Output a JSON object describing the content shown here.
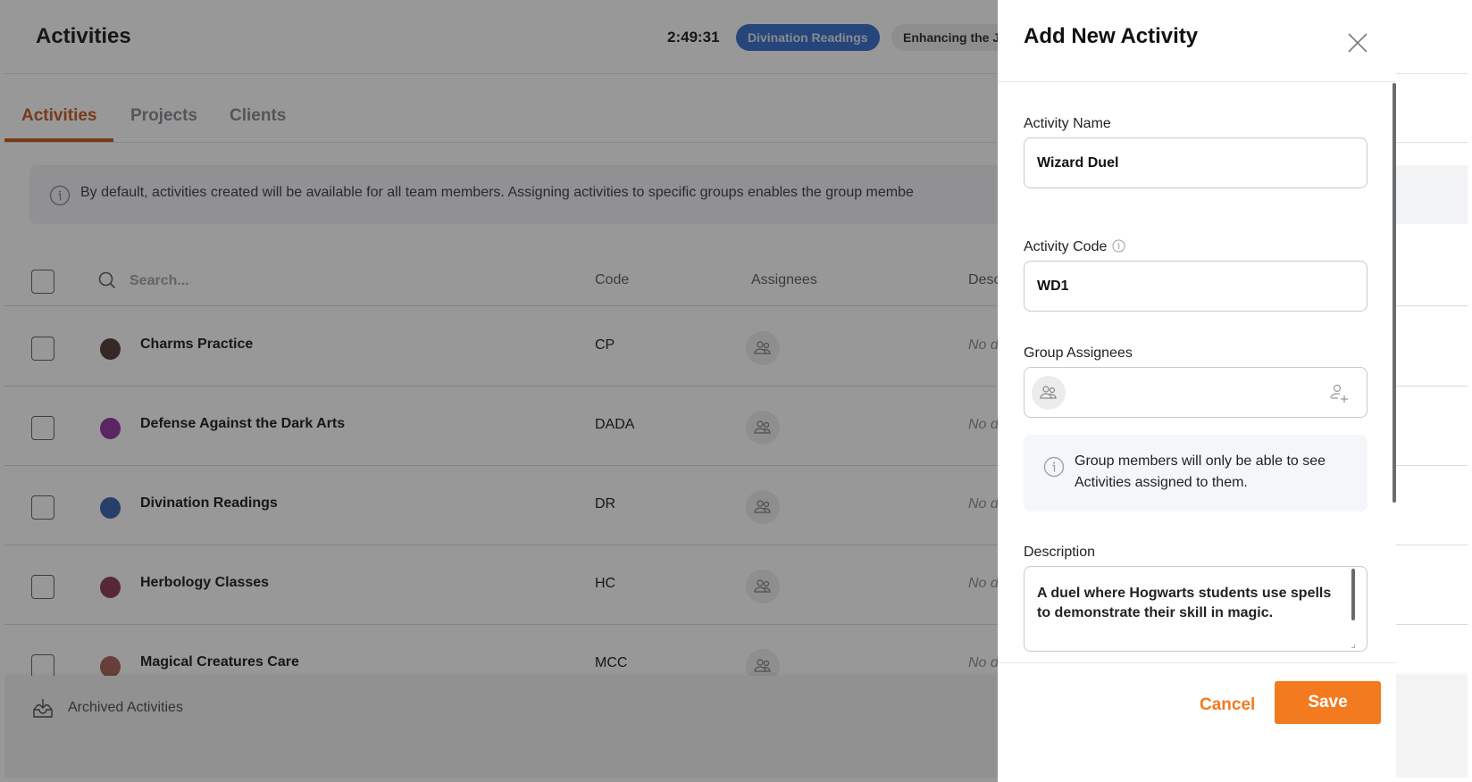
{
  "header": {
    "title": "Activities",
    "timer": "2:49:31",
    "active_chip": "Divination Readings",
    "next_chip": "Enhancing the J"
  },
  "tabs": [
    {
      "label": "Activities",
      "active": true
    },
    {
      "label": "Projects",
      "active": false
    },
    {
      "label": "Clients",
      "active": false
    }
  ],
  "banner": {
    "text": "By default, activities created will be available for all team members. Assigning activities to specific groups enables the group membe"
  },
  "table": {
    "search_placeholder": "Search...",
    "columns": {
      "code": "Code",
      "assignees": "Assignees",
      "description": "Desc"
    },
    "rows": [
      {
        "name": "Charms Practice",
        "code": "CP",
        "color": "#4a332c",
        "description": "No d"
      },
      {
        "name": "Defense Against the Dark Arts",
        "code": "DADA",
        "color": "#8e2a9e",
        "description": "No d"
      },
      {
        "name": "Divination Readings",
        "code": "DR",
        "color": "#2c5aab",
        "description": "No d"
      },
      {
        "name": "Herbology Classes",
        "code": "HC",
        "color": "#86304a",
        "description": "No d"
      },
      {
        "name": "Magical Creatures Care",
        "code": "MCC",
        "color": "#a45a52",
        "description": "No d"
      }
    ]
  },
  "footer": {
    "archived_label": "Archived Activities"
  },
  "drawer": {
    "title": "Add New Activity",
    "activity_name_label": "Activity Name",
    "activity_name_value": "Wizard Duel",
    "activity_code_label": "Activity Code",
    "activity_code_value": "WD1",
    "group_assignees_label": "Group Assignees",
    "group_note": "Group members will only be able to see Activities assigned to them.",
    "description_label": "Description",
    "description_value": "A duel where Hogwarts students use spells to demonstrate their skill in magic.",
    "cancel_label": "Cancel",
    "save_label": "Save"
  },
  "colors": {
    "accent": "#f47a20",
    "tab_active": "#c25418",
    "chip_active": "#2e66c8"
  }
}
